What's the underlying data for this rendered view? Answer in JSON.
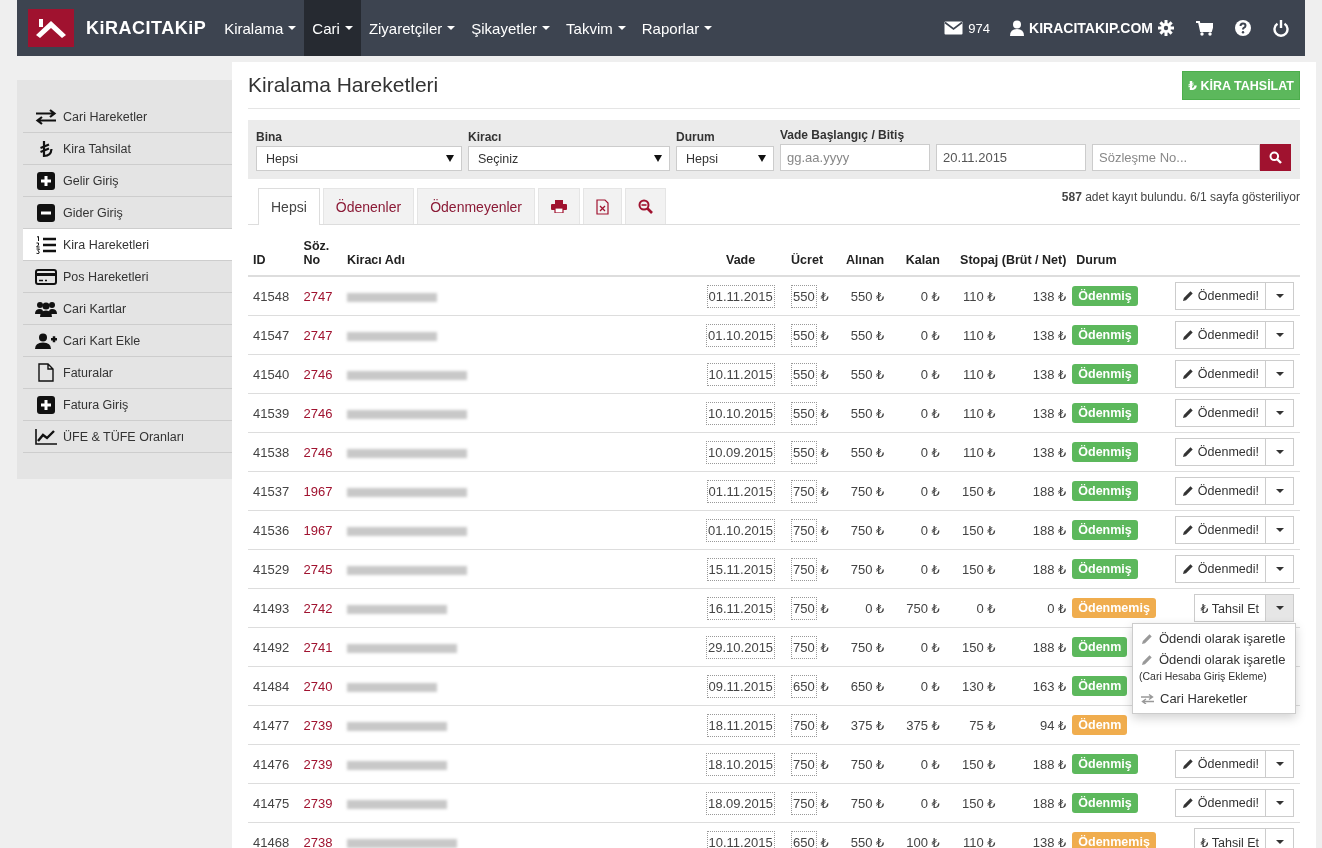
{
  "navbar": {
    "brand": "KiRACITAKiP",
    "menus": [
      {
        "label": "Kiralama",
        "selected": false
      },
      {
        "label": "Cari",
        "selected": true
      },
      {
        "label": "Ziyaretçiler",
        "selected": false
      },
      {
        "label": "Şikayetler",
        "selected": false
      },
      {
        "label": "Takvim",
        "selected": false
      },
      {
        "label": "Raporlar",
        "selected": false
      }
    ],
    "mail_count": "974",
    "user": "KIRACITAKIP.COM"
  },
  "sidebar": {
    "items": [
      {
        "label": "Cari Hareketler",
        "selected": false
      },
      {
        "label": "Kira Tahsilat",
        "selected": false
      },
      {
        "label": "Gelir Giriş",
        "selected": false
      },
      {
        "label": "Gider Giriş",
        "selected": false
      },
      {
        "label": "Kira Hareketleri",
        "selected": true
      },
      {
        "label": "Pos Hareketleri",
        "selected": false
      },
      {
        "label": "Cari Kartlar",
        "selected": false
      },
      {
        "label": "Cari Kart Ekle",
        "selected": false
      },
      {
        "label": "Faturalar",
        "selected": false
      },
      {
        "label": "Fatura Giriş",
        "selected": false
      },
      {
        "label": "ÜFE & TÜFE Oranları",
        "selected": false
      }
    ]
  },
  "page": {
    "title": "Kiralama Hareketleri",
    "primary_button": "₺ KİRA TAHSİLAT"
  },
  "filters": {
    "fields": [
      {
        "kind": "select",
        "label": "Bina",
        "value": "Hepsi"
      },
      {
        "kind": "select",
        "label": "Kiracı",
        "value": "Seçiniz"
      },
      {
        "kind": "select",
        "label": "Durum",
        "value": "Hepsi"
      },
      {
        "kind": "date",
        "label": "Vade Başlangıç / Bitiş",
        "placeholder": "gg.aa.yyyy"
      },
      {
        "kind": "date",
        "value": "20.11.2015"
      },
      {
        "kind": "search",
        "placeholder": "Sözleşme No..."
      }
    ]
  },
  "tabs": [
    {
      "kind": "text",
      "label": "Hepsi",
      "selected": true
    },
    {
      "kind": "text",
      "label": "Ödenenler",
      "selected": false
    },
    {
      "kind": "text",
      "label": "Ödenmeyenler",
      "selected": false
    },
    {
      "kind": "print",
      "selected": false
    },
    {
      "kind": "excel",
      "selected": false
    },
    {
      "kind": "zoom",
      "selected": false
    }
  ],
  "result_info": "**587** adet kayıt bulundu. 6/1 sayfa gösteriliyor",
  "table": {
    "columns": [
      "ID",
      "Söz. No",
      "Kiracı Adı",
      "Vade",
      "Ücret",
      "Alınan",
      "Kalan",
      "Stopaj (Brüt / Net)",
      "Durum"
    ],
    "rows": [
      {
        "id": "41548",
        "contract": "2747",
        "due": "01.11.2015",
        "fee": "550",
        "fee_unit": "₺",
        "received": "550 ₺",
        "remaining": "0 ₺",
        "gross": "110 ₺",
        "net": "138 ₺",
        "kind": "paid",
        "status_text": "Ödenmiş",
        "action": {
          "kind": "unmark",
          "label": "Ödenmedi!",
          "menu_open": false
        }
      },
      {
        "id": "41547",
        "contract": "2747",
        "due": "01.10.2015",
        "fee": "550",
        "fee_unit": "₺",
        "received": "550 ₺",
        "remaining": "0 ₺",
        "gross": "110 ₺",
        "net": "138 ₺",
        "kind": "paid",
        "status_text": "Ödenmiş",
        "action": {
          "kind": "unmark",
          "label": "Ödenmedi!",
          "menu_open": false
        }
      },
      {
        "id": "41540",
        "contract": "2746",
        "due": "10.11.2015",
        "fee": "550",
        "fee_unit": "₺",
        "received": "550 ₺",
        "remaining": "0 ₺",
        "gross": "110 ₺",
        "net": "138 ₺",
        "kind": "paid",
        "status_text": "Ödenmiş",
        "action": {
          "kind": "unmark",
          "label": "Ödenmedi!",
          "menu_open": false
        }
      },
      {
        "id": "41539",
        "contract": "2746",
        "due": "10.10.2015",
        "fee": "550",
        "fee_unit": "₺",
        "received": "550 ₺",
        "remaining": "0 ₺",
        "gross": "110 ₺",
        "net": "138 ₺",
        "kind": "paid",
        "status_text": "Ödenmiş",
        "action": {
          "kind": "unmark",
          "label": "Ödenmedi!",
          "menu_open": false
        }
      },
      {
        "id": "41538",
        "contract": "2746",
        "due": "10.09.2015",
        "fee": "550",
        "fee_unit": "₺",
        "received": "550 ₺",
        "remaining": "0 ₺",
        "gross": "110 ₺",
        "net": "138 ₺",
        "kind": "paid",
        "status_text": "Ödenmiş",
        "action": {
          "kind": "unmark",
          "label": "Ödenmedi!",
          "menu_open": false
        }
      },
      {
        "id": "41537",
        "contract": "1967",
        "due": "01.11.2015",
        "fee": "750",
        "fee_unit": "₺",
        "received": "750 ₺",
        "remaining": "0 ₺",
        "gross": "150 ₺",
        "net": "188 ₺",
        "kind": "paid",
        "status_text": "Ödenmiş",
        "action": {
          "kind": "unmark",
          "label": "Ödenmedi!",
          "menu_open": false
        }
      },
      {
        "id": "41536",
        "contract": "1967",
        "due": "01.10.2015",
        "fee": "750",
        "fee_unit": "₺",
        "received": "750 ₺",
        "remaining": "0 ₺",
        "gross": "150 ₺",
        "net": "188 ₺",
        "kind": "paid",
        "status_text": "Ödenmiş",
        "action": {
          "kind": "unmark",
          "label": "Ödenmedi!",
          "menu_open": false
        }
      },
      {
        "id": "41529",
        "contract": "2745",
        "due": "15.11.2015",
        "fee": "750",
        "fee_unit": "₺",
        "received": "750 ₺",
        "remaining": "0 ₺",
        "gross": "150 ₺",
        "net": "188 ₺",
        "kind": "paid",
        "status_text": "Ödenmiş",
        "action": {
          "kind": "unmark",
          "label": "Ödenmedi!",
          "menu_open": false
        }
      },
      {
        "id": "41493",
        "contract": "2742",
        "due": "16.11.2015",
        "fee": "750",
        "fee_unit": "₺",
        "received": "0 ₺",
        "remaining": "750 ₺",
        "gross": "0 ₺",
        "net": "0 ₺",
        "kind": "unpaid",
        "status_text": "Ödenmemiş",
        "action": {
          "kind": "collect",
          "label": "₺ Tahsil Et",
          "menu_open": true
        }
      },
      {
        "id": "41492",
        "contract": "2741",
        "due": "29.10.2015",
        "fee": "750",
        "fee_unit": "₺",
        "received": "750 ₺",
        "remaining": "0 ₺",
        "gross": "150 ₺",
        "net": "188 ₺",
        "kind": "paid",
        "status_text": "Ödenm"
      },
      {
        "id": "41484",
        "contract": "2740",
        "due": "09.11.2015",
        "fee": "650",
        "fee_unit": "₺",
        "received": "650 ₺",
        "remaining": "0 ₺",
        "gross": "130 ₺",
        "net": "163 ₺",
        "kind": "paid",
        "status_text": "Ödenm"
      },
      {
        "id": "41477",
        "contract": "2739",
        "due": "18.11.2015",
        "fee": "750",
        "fee_unit": "₺",
        "received": "375 ₺",
        "remaining": "375 ₺",
        "gross": "75 ₺",
        "net": "94 ₺",
        "kind": "unpaid",
        "status_text": "Ödenm"
      },
      {
        "id": "41476",
        "contract": "2739",
        "due": "18.10.2015",
        "fee": "750",
        "fee_unit": "₺",
        "received": "750 ₺",
        "remaining": "0 ₺",
        "gross": "150 ₺",
        "net": "188 ₺",
        "kind": "paid",
        "status_text": "Ödenmiş",
        "action": {
          "kind": "unmark",
          "label": "Ödenmedi!",
          "menu_open": false
        }
      },
      {
        "id": "41475",
        "contract": "2739",
        "due": "18.09.2015",
        "fee": "750",
        "fee_unit": "₺",
        "received": "750 ₺",
        "remaining": "0 ₺",
        "gross": "150 ₺",
        "net": "188 ₺",
        "kind": "paid",
        "status_text": "Ödenmiş",
        "action": {
          "kind": "unmark",
          "label": "Ödenmedi!",
          "menu_open": false
        }
      },
      {
        "id": "41468",
        "contract": "2738",
        "due": "10.11.2015",
        "fee": "650",
        "fee_unit": "₺",
        "received": "550 ₺",
        "remaining": "100 ₺",
        "gross": "110 ₺",
        "net": "138 ₺",
        "kind": "unpaid",
        "status_text": "Ödenmemiş",
        "action": {
          "kind": "collect",
          "label": "₺ Tahsil Et",
          "menu_open": false
        }
      }
    ]
  },
  "action_menu": {
    "items": [
      {
        "kind": "pencil",
        "label": "Ödendi olarak işaretle"
      },
      {
        "kind": "pencil",
        "label": "Ödendi olarak işaretle",
        "note": "(Cari Hesaba Giriş Ekleme)"
      },
      {
        "kind": "exchange",
        "label": "Cari Hareketler"
      }
    ]
  }
}
